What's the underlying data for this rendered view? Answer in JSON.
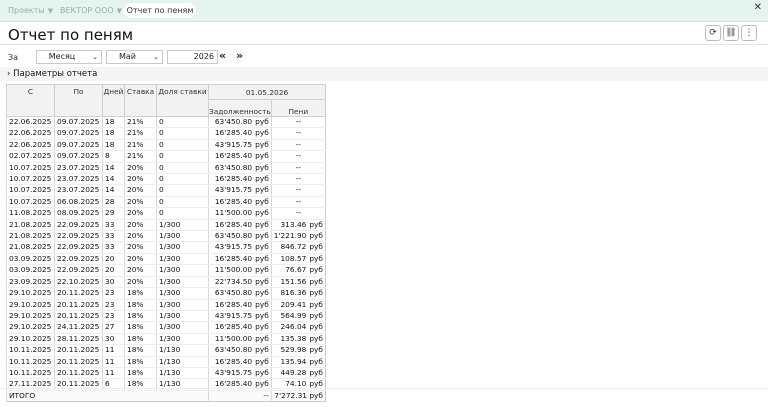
{
  "tabs": [
    {
      "label": "Проекты"
    },
    {
      "label": "ВЕКТОР ООО"
    },
    {
      "label": "Отчет по пеням"
    }
  ],
  "close_glyph": "✕",
  "page": {
    "title": "Отчет по пеням"
  },
  "toolbar": {
    "refresh": "⟳",
    "link": "⛓",
    "more": "⋮"
  },
  "filter": {
    "label": "За",
    "period": "Месяц",
    "month": "Май",
    "year": "2026",
    "prev": "«",
    "next": "»",
    "params_label": "Параметры отчета"
  },
  "table": {
    "headers": {
      "from": "С",
      "to": "По",
      "days": "Дней",
      "rate": "Ставка",
      "share": "Доля ставки",
      "date": "01.05.2026",
      "debt": "Задолженность",
      "penalty": "Пени"
    },
    "rows": [
      {
        "from": "22.06.2025",
        "to": "09.07.2025",
        "days": "18",
        "rate": "21%",
        "share": "0",
        "debt": "63'450.80",
        "debt_unit": "руб",
        "penalty": "--",
        "pen_unit": ""
      },
      {
        "from": "22.06.2025",
        "to": "09.07.2025",
        "days": "18",
        "rate": "21%",
        "share": "0",
        "debt": "16'285.40",
        "debt_unit": "руб",
        "penalty": "--",
        "pen_unit": ""
      },
      {
        "from": "22.06.2025",
        "to": "09.07.2025",
        "days": "18",
        "rate": "21%",
        "share": "0",
        "debt": "43'915.75",
        "debt_unit": "руб",
        "penalty": "--",
        "pen_unit": ""
      },
      {
        "from": "02.07.2025",
        "to": "09.07.2025",
        "days": "8",
        "rate": "21%",
        "share": "0",
        "debt": "16'285.40",
        "debt_unit": "руб",
        "penalty": "--",
        "pen_unit": ""
      },
      {
        "from": "10.07.2025",
        "to": "23.07.2025",
        "days": "14",
        "rate": "20%",
        "share": "0",
        "debt": "63'450.80",
        "debt_unit": "руб",
        "penalty": "--",
        "pen_unit": ""
      },
      {
        "from": "10.07.2025",
        "to": "23.07.2025",
        "days": "14",
        "rate": "20%",
        "share": "0",
        "debt": "16'285.40",
        "debt_unit": "руб",
        "penalty": "--",
        "pen_unit": ""
      },
      {
        "from": "10.07.2025",
        "to": "23.07.2025",
        "days": "14",
        "rate": "20%",
        "share": "0",
        "debt": "43'915.75",
        "debt_unit": "руб",
        "penalty": "--",
        "pen_unit": ""
      },
      {
        "from": "10.07.2025",
        "to": "06.08.2025",
        "days": "28",
        "rate": "20%",
        "share": "0",
        "debt": "16'285.40",
        "debt_unit": "руб",
        "penalty": "--",
        "pen_unit": ""
      },
      {
        "from": "11.08.2025",
        "to": "08.09.2025",
        "days": "29",
        "rate": "20%",
        "share": "0",
        "debt": "11'500.00",
        "debt_unit": "руб",
        "penalty": "--",
        "pen_unit": ""
      },
      {
        "from": "21.08.2025",
        "to": "22.09.2025",
        "days": "33",
        "rate": "20%",
        "share": "1/300",
        "debt": "16'285.40",
        "debt_unit": "руб",
        "penalty": "313.46",
        "pen_unit": "руб"
      },
      {
        "from": "21.08.2025",
        "to": "22.09.2025",
        "days": "33",
        "rate": "20%",
        "share": "1/300",
        "debt": "63'450.80",
        "debt_unit": "руб",
        "penalty": "1'221.90",
        "pen_unit": "руб"
      },
      {
        "from": "21.08.2025",
        "to": "22.09.2025",
        "days": "33",
        "rate": "20%",
        "share": "1/300",
        "debt": "43'915.75",
        "debt_unit": "руб",
        "penalty": "846.72",
        "pen_unit": "руб"
      },
      {
        "from": "03.09.2025",
        "to": "22.09.2025",
        "days": "20",
        "rate": "20%",
        "share": "1/300",
        "debt": "16'285.40",
        "debt_unit": "руб",
        "penalty": "108.57",
        "pen_unit": "руб"
      },
      {
        "from": "03.09.2025",
        "to": "22.09.2025",
        "days": "20",
        "rate": "20%",
        "share": "1/300",
        "debt": "11'500.00",
        "debt_unit": "руб",
        "penalty": "76.67",
        "pen_unit": "руб"
      },
      {
        "from": "23.09.2025",
        "to": "22.10.2025",
        "days": "30",
        "rate": "20%",
        "share": "1/300",
        "debt": "22'734.50",
        "debt_unit": "руб",
        "penalty": "151.56",
        "pen_unit": "руб"
      },
      {
        "from": "29.10.2025",
        "to": "20.11.2025",
        "days": "23",
        "rate": "18%",
        "share": "1/300",
        "debt": "63'450.80",
        "debt_unit": "руб",
        "penalty": "816.36",
        "pen_unit": "руб"
      },
      {
        "from": "29.10.2025",
        "to": "20.11.2025",
        "days": "23",
        "rate": "18%",
        "share": "1/300",
        "debt": "16'285.40",
        "debt_unit": "руб",
        "penalty": "209.41",
        "pen_unit": "руб"
      },
      {
        "from": "29.10.2025",
        "to": "20.11.2025",
        "days": "23",
        "rate": "18%",
        "share": "1/300",
        "debt": "43'915.75",
        "debt_unit": "руб",
        "penalty": "564.99",
        "pen_unit": "руб"
      },
      {
        "from": "29.10.2025",
        "to": "24.11.2025",
        "days": "27",
        "rate": "18%",
        "share": "1/300",
        "debt": "16'285.40",
        "debt_unit": "руб",
        "penalty": "246.04",
        "pen_unit": "руб"
      },
      {
        "from": "29.10.2025",
        "to": "28.11.2025",
        "days": "30",
        "rate": "18%",
        "share": "1/300",
        "debt": "11'500.00",
        "debt_unit": "руб",
        "penalty": "135.38",
        "pen_unit": "руб"
      },
      {
        "from": "10.11.2025",
        "to": "20.11.2025",
        "days": "11",
        "rate": "18%",
        "share": "1/130",
        "debt": "63'450.80",
        "debt_unit": "руб",
        "penalty": "529.98",
        "pen_unit": "руб"
      },
      {
        "from": "10.11.2025",
        "to": "20.11.2025",
        "days": "11",
        "rate": "18%",
        "share": "1/130",
        "debt": "16'285.40",
        "debt_unit": "руб",
        "penalty": "135.94",
        "pen_unit": "руб"
      },
      {
        "from": "10.11.2025",
        "to": "20.11.2025",
        "days": "11",
        "rate": "18%",
        "share": "1/130",
        "debt": "43'915.75",
        "debt_unit": "руб",
        "penalty": "449.28",
        "pen_unit": "руб"
      },
      {
        "from": "27.11.2025",
        "to": "20.11.2025",
        "days": "6",
        "rate": "18%",
        "share": "1/130",
        "debt": "16'285.40",
        "debt_unit": "руб",
        "penalty": "74.10",
        "pen_unit": "руб"
      }
    ],
    "total": {
      "label": "ИТОГО",
      "debt": "--",
      "penalty": "7'272.31",
      "pen_unit": "руб"
    }
  }
}
